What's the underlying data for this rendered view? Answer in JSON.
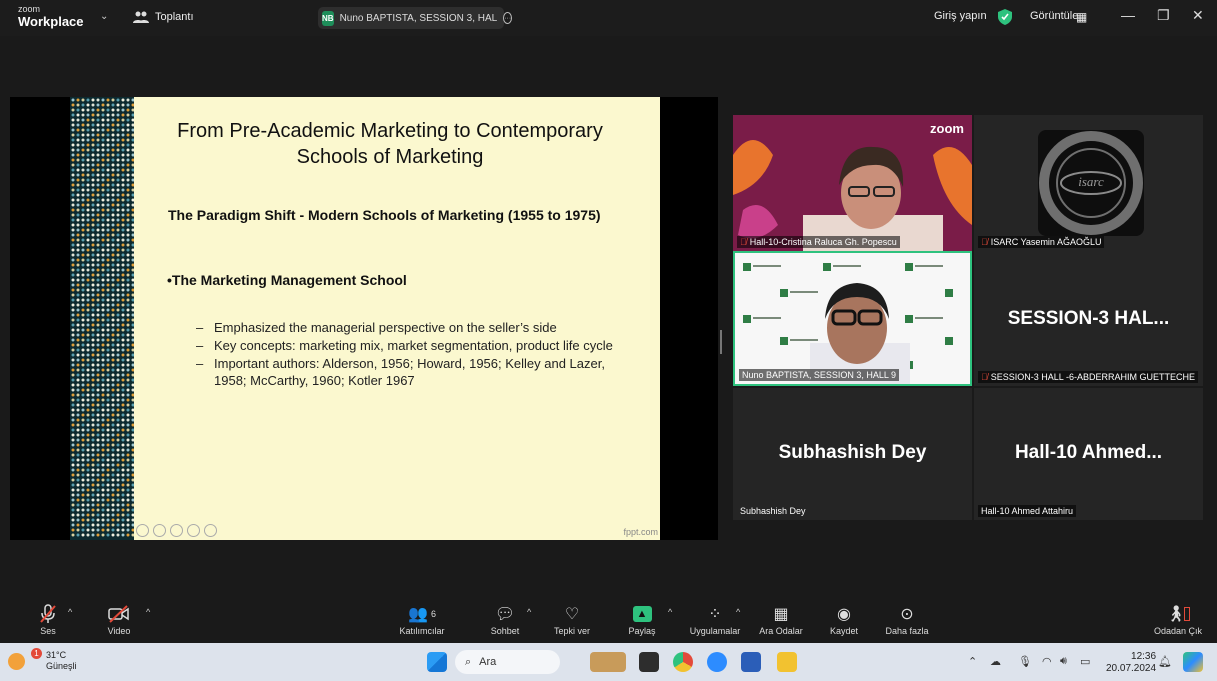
{
  "titlebar": {
    "logo_top": "zoom",
    "logo_bottom": "Workplace",
    "meeting_label": "Toplantı",
    "speaker_initials": "NB",
    "speaker_pill": "Nuno BAPTISTA, SESSION 3, HAL",
    "signin": "Giriş yapın",
    "view": "Görüntüle"
  },
  "slide": {
    "title": "From Pre-Academic Marketing to Contemporary Schools of Marketing",
    "subtitle": "The Paradigm Shift  - Modern Schools of Marketing (1955 to 1975)",
    "school": "•The Marketing Management School",
    "points": [
      "Emphasized the managerial perspective on the seller’s side",
      "Key concepts: marketing mix, market segmentation, product life cycle",
      "Important authors: Alderson, 1956; Howard, 1956; Kelley and Lazer, 1958; McCarthy,  1960; Kotler 1967"
    ],
    "footer": "fppt.com"
  },
  "gallery": {
    "tiles": [
      {
        "label": "Hall-10-Cristina Raluca Gh. Popescu",
        "muted": true
      },
      {
        "label": "ISARC Yasemin AĞAOĞLU",
        "muted": true
      },
      {
        "label": "Nuno BAPTISTA, SESSION 3, HALL 9",
        "muted": false
      },
      {
        "label": "SESSION-3 HALL -6-ABDERRAHIM GUETTECHE",
        "big": "SESSION-3  HAL...",
        "muted": true
      },
      {
        "label": "Subhashish Dey",
        "big": "Subhashish Dey",
        "muted": false
      },
      {
        "label": "Hall-10 Ahmed Attahiru",
        "big": "Hall-10  Ahmed...",
        "muted": false
      }
    ],
    "zoom_tag": "zoom",
    "isarc_logo_text": "isarc"
  },
  "toolbar": {
    "audio": "Ses",
    "video": "Video",
    "participants": "Katılımcılar",
    "participants_count": "6",
    "chat": "Sohbet",
    "react": "Tepki ver",
    "share": "Paylaş",
    "apps": "Uygulamalar",
    "rooms": "Ara Odalar",
    "record": "Kaydet",
    "more": "Daha fazla",
    "leave": "Odadan Çık"
  },
  "taskbar": {
    "temp": "31°C",
    "weather": "Güneşli",
    "weather_badge": "1",
    "search": "Ara",
    "time": "12:36",
    "date": "20.07.2024"
  }
}
